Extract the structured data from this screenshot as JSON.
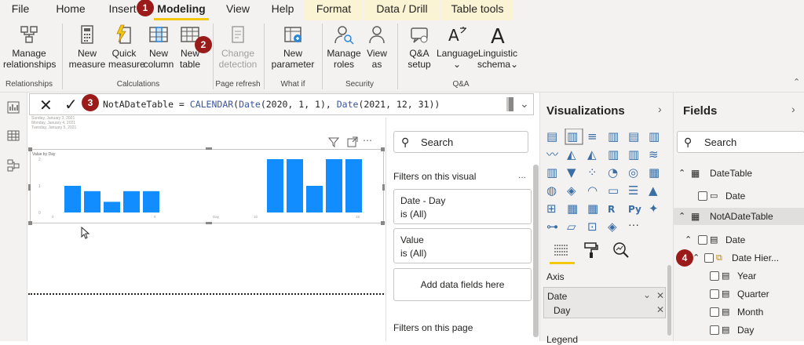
{
  "menubar": {
    "tabs": [
      "File",
      "Home",
      "Insert",
      "Modeling",
      "View",
      "Help"
    ],
    "context_tabs": [
      "Format",
      "Data / Drill",
      "Table tools"
    ],
    "active_tab": "Modeling",
    "accent": "#f2c811"
  },
  "ribbon": {
    "manage_relationships": {
      "line1": "Manage",
      "line2": "relationships"
    },
    "relationships_group": "Relationships",
    "new_measure": {
      "line1": "New",
      "line2": "measure"
    },
    "quick_measure": {
      "line1": "Quick",
      "line2": "measure"
    },
    "new_column": {
      "line1": "New",
      "line2": "column"
    },
    "new_table": {
      "line1": "New",
      "line2": "table"
    },
    "calculations_group": "Calculations",
    "change_detection": {
      "line1": "Change",
      "line2": "detection"
    },
    "page_refresh_group": "Page refresh",
    "new_parameter": {
      "line1": "New",
      "line2": "parameter"
    },
    "whatif_group": "What if",
    "manage_roles": {
      "line1": "Manage",
      "line2": "roles"
    },
    "view_as": {
      "line1": "View",
      "line2": "as"
    },
    "security_group": "Security",
    "qa_setup": {
      "line1": "Q&A",
      "line2": "setup"
    },
    "language": {
      "line1": "Language",
      "line2": "⌄"
    },
    "linguistic_schema": {
      "line1": "Linguistic",
      "line2": "schema⌄"
    },
    "qa_group": "Q&A"
  },
  "badges": [
    "1",
    "2",
    "3",
    "4"
  ],
  "formula": {
    "table_name": "NotADateTable = ",
    "fn1": "CALENDAR",
    "arg_open": "(",
    "fn2": "Date",
    "args1": "(2020, 1, 1), ",
    "fn3": "Date",
    "args2": "(2021, 12, 31))"
  },
  "chart_data": {
    "type": "bar",
    "title": "Value by Day",
    "legend_rows": [
      "Sunday, January 3, 2021",
      "Monday, January 4, 2021",
      "Tuesday, January 5, 2021"
    ],
    "y_ticks": [
      "2",
      "1",
      "0"
    ],
    "x_ticks": [
      "0",
      "5",
      "Day",
      "10",
      "15"
    ],
    "values_left": [
      1.0,
      0.8,
      0.4,
      0.8,
      0.8
    ],
    "values_right": [
      2.0,
      2.0,
      1.0,
      2.0,
      2.0
    ],
    "ylim": [
      0,
      2
    ],
    "color": "#118dff"
  },
  "filters": {
    "search_placeholder": "Search",
    "on_visual": "Filters on this visual",
    "more": "...",
    "cards": [
      {
        "field": "Date - Day",
        "state": "is (All)"
      },
      {
        "field": "Value",
        "state": "is (All)"
      }
    ],
    "add_fields": "Add data fields here",
    "on_page": "Filters on this page"
  },
  "viz": {
    "title": "Visualizations",
    "axis_label": "Axis",
    "axis_field1": "Date",
    "axis_field2": "Day",
    "legend_label": "Legend",
    "more": "···"
  },
  "fields": {
    "title": "Fields",
    "search_placeholder": "Search",
    "tables": [
      {
        "name": "DateTable",
        "columns": [
          "Date"
        ]
      },
      {
        "name": "NotADateTable",
        "columns": [
          "Date"
        ]
      }
    ],
    "hierarchy": "Date Hier...",
    "levels": [
      "Year",
      "Quarter",
      "Month",
      "Day"
    ]
  }
}
